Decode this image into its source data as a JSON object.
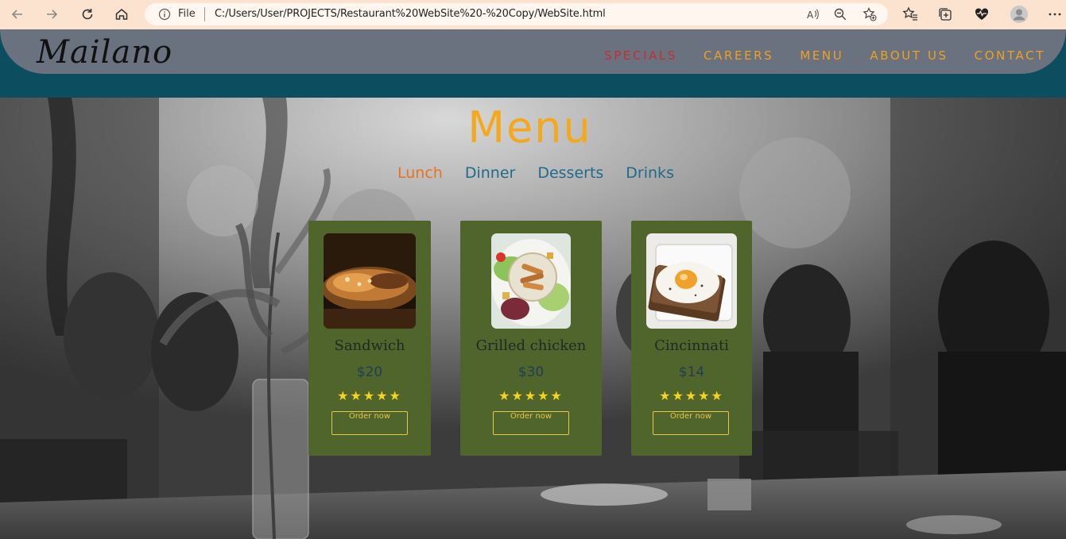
{
  "browser": {
    "file_label": "File",
    "url": "C:/Users/User/PROJECTS/Restaurant%20WebSite%20-%20Copy/WebSite.html",
    "accent_bg": "#fbe3cf"
  },
  "site": {
    "logo": "Mailano",
    "nav": [
      {
        "label": "SPECIALS",
        "active": true
      },
      {
        "label": "CAREERS",
        "active": false
      },
      {
        "label": "MENU",
        "active": false
      },
      {
        "label": "ABOUT US",
        "active": false
      },
      {
        "label": "CONTACT",
        "active": false
      }
    ],
    "colors": {
      "nav_bg": "#6a7280",
      "band": "#0d4d60",
      "link": "#f0a020",
      "link_active": "#c23030",
      "card": "#4f652c",
      "star": "#f7d21c"
    }
  },
  "menu": {
    "title": "Menu",
    "tabs": [
      {
        "label": "Lunch",
        "active": true
      },
      {
        "label": "Dinner",
        "active": false
      },
      {
        "label": "Desserts",
        "active": false
      },
      {
        "label": "Drinks",
        "active": false
      }
    ],
    "items": [
      {
        "name": "Sandwich",
        "price": "$20",
        "rating": 5,
        "stars": "★★★★★",
        "button": "Order now",
        "image": "sandwich-photo"
      },
      {
        "name": "Grilled chicken",
        "price": "$30",
        "rating": 5,
        "stars": "★★★★★",
        "button": "Order now",
        "image": "chicken-salad-photo"
      },
      {
        "name": "Cincinnati",
        "price": "$14",
        "rating": 5,
        "stars": "★★★★★",
        "button": "Order now",
        "image": "egg-toast-photo"
      }
    ]
  }
}
